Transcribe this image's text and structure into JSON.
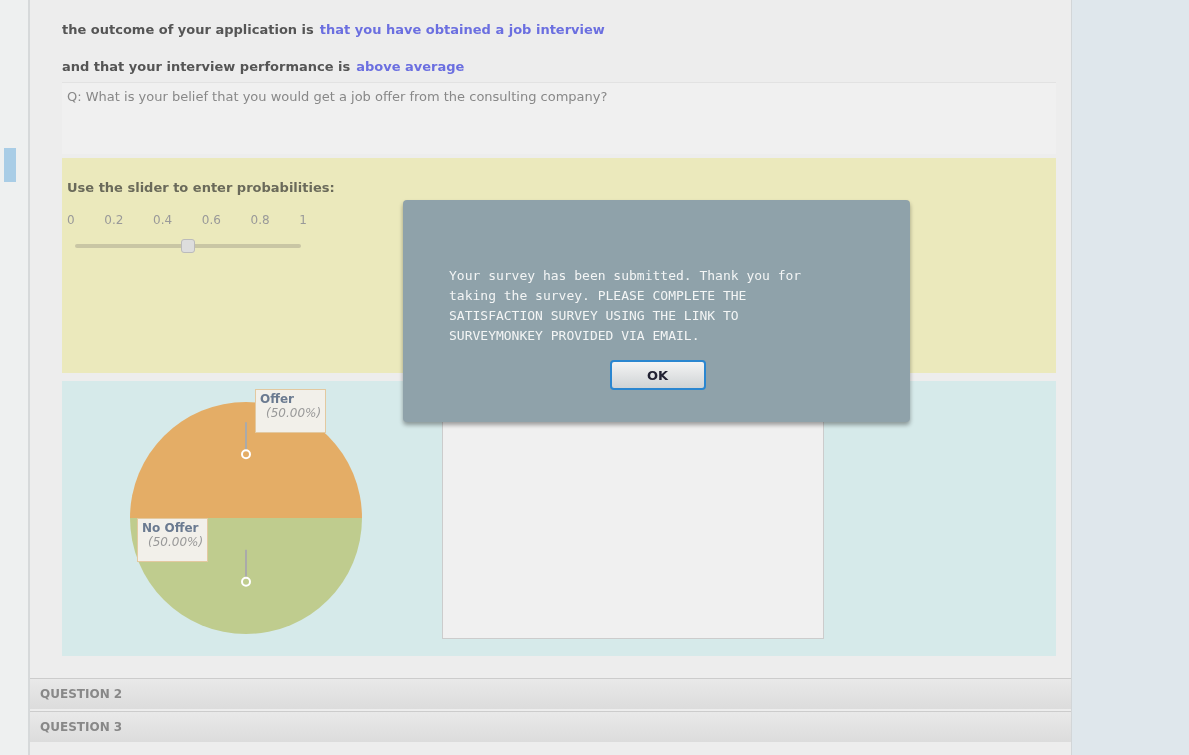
{
  "context": [
    {
      "label": "the outcome of your application is",
      "value": "that you have obtained a job interview"
    },
    {
      "label": "and that your interview performance is",
      "value": "above average"
    }
  ],
  "question": "Q: What is your belief that you would get a job offer from the consulting company?",
  "slider": {
    "label": "Use the slider to enter probabilities:",
    "ticks": [
      "0",
      "0.2",
      "0.4",
      "0.6",
      "0.8",
      "1"
    ],
    "level": 0.5
  },
  "chart_data": {
    "type": "pie",
    "categories": [
      "Offer",
      "No Offer"
    ],
    "values": [
      50,
      50
    ],
    "value_labels": [
      "(50.00%)",
      "(50.00%)"
    ],
    "colors": [
      "#e4ad66",
      "#bfcc8e"
    ]
  },
  "sections": [
    {
      "label": "QUESTION 2"
    },
    {
      "label": "QUESTION 3"
    }
  ],
  "dialog": {
    "message": "Your survey has been submitted. Thank you for taking the survey. PLEASE COMPLETE THE SATISFACTION SURVEY USING THE LINK TO SURVEYMONKEY PROVIDED VIA EMAIL.",
    "button": "OK"
  }
}
